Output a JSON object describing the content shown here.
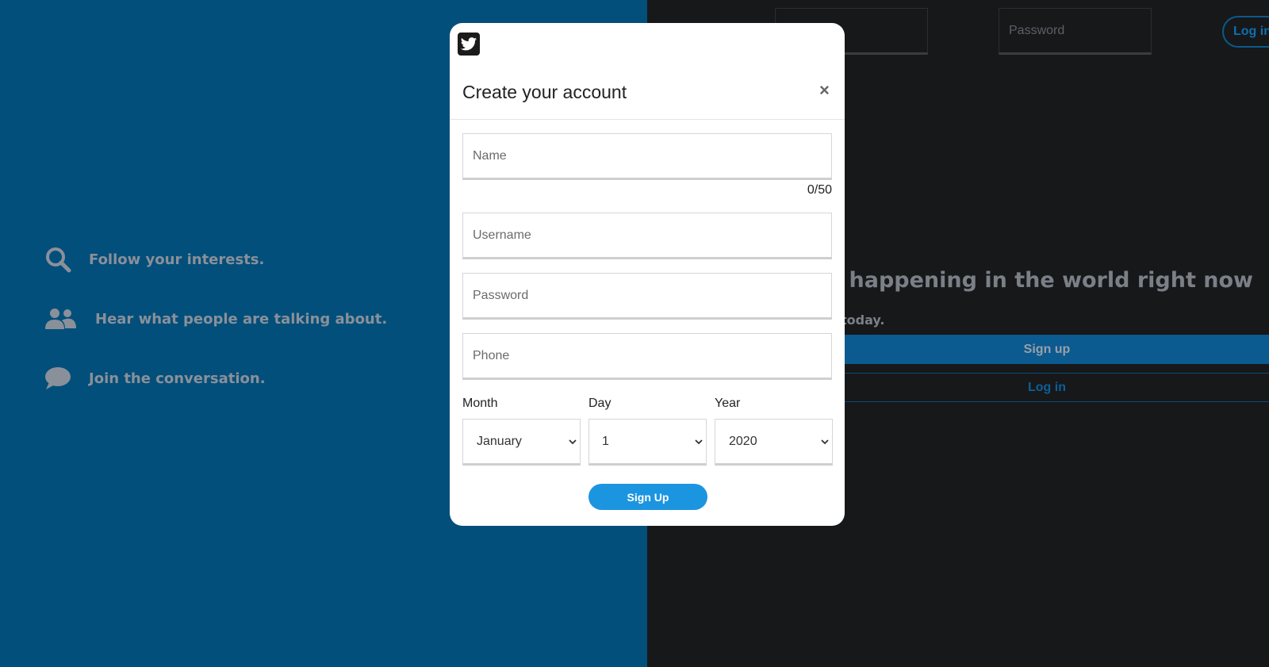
{
  "features": [
    {
      "icon": "search-icon",
      "label": "Follow your interests."
    },
    {
      "icon": "users-icon",
      "label": "Hear what people are talking about."
    },
    {
      "icon": "chat-bubble-icon",
      "label": "Join the conversation."
    }
  ],
  "top_login": {
    "username_placeholder": "",
    "password_placeholder": "Password",
    "login_label": "Log in"
  },
  "hero": {
    "title": "at's happening in the world right now",
    "subtitle": "today.",
    "signup_label": "Sign up",
    "login_label": "Log in"
  },
  "modal": {
    "logo_icon": "twitter-bird-icon",
    "title": "Create your account",
    "close_label": "×",
    "name_placeholder": "Name",
    "name_counter": "0/50",
    "username_placeholder": "Username",
    "password_placeholder": "Password",
    "phone_placeholder": "Phone",
    "month_label": "Month",
    "day_label": "Day",
    "year_label": "Year",
    "month_value": "January",
    "day_value": "1",
    "year_value": "2020",
    "submit_label": "Sign Up"
  },
  "colors": {
    "left_bg": "#034f7b",
    "right_bg": "#17181a",
    "accent": "#1b95e0"
  }
}
